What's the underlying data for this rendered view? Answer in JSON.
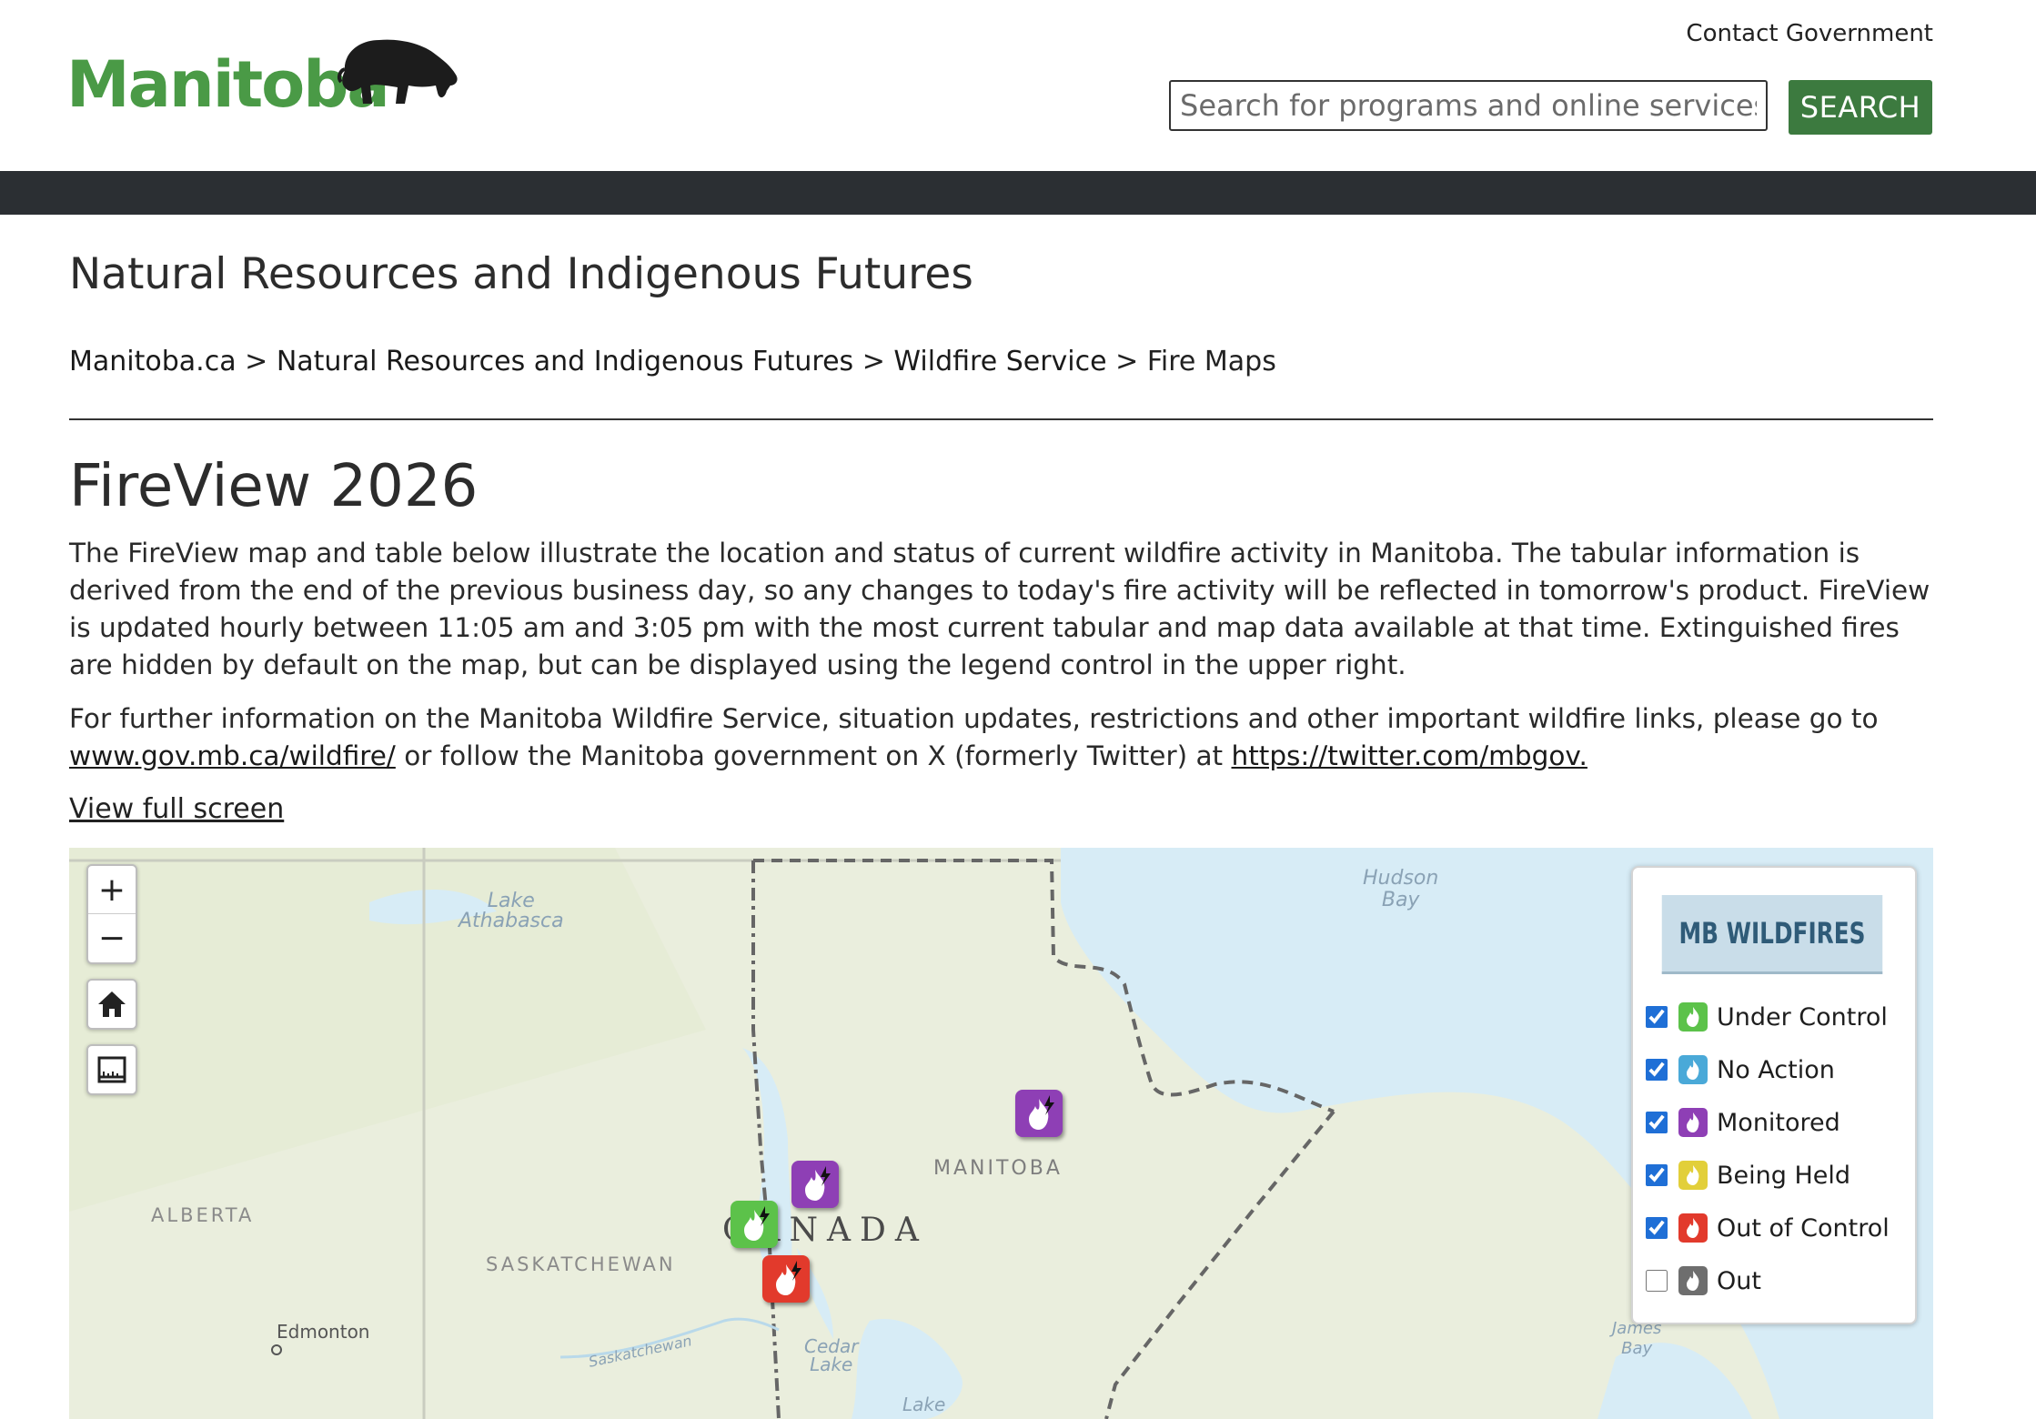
{
  "header": {
    "logo_text": "Manitoba",
    "contact_label": "Contact Government",
    "search_placeholder": "Search for programs and online services",
    "search_button": "SEARCH"
  },
  "department": "Natural Resources and Indigenous Futures",
  "breadcrumb": [
    "Manitoba.ca",
    ">",
    "Natural Resources and Indigenous Futures",
    ">",
    "Wildfire Service",
    ">",
    "Fire Maps"
  ],
  "page_title": "FireView 2026",
  "intro": "The FireView map and table below illustrate the location and status of current wildfire activity in Manitoba. The tabular information is derived from the end of the previous business day, so any changes to today's fire activity will be reflected in tomorrow's product. FireView is updated hourly between 11:05 am and 3:05 pm with the most current tabular and map data available at that time. Extinguished fires are hidden by default on the map, but can be displayed using the legend control in the upper right.",
  "info": {
    "text_before": "For further information on the Manitoba Wildfire Service, situation updates, restrictions and other important wildfire links, please go to",
    "link1": "www.gov.mb.ca/wildfire/",
    "text_middle": "or follow the Manitoba government on X (formerly Twitter) at",
    "link2": "https://twitter.com/mbgov."
  },
  "fullscreen_link": "View full screen",
  "map": {
    "controls": {
      "zoom_in": "+",
      "zoom_out": "−"
    },
    "labels": {
      "hudson_bay_1": "Hudson",
      "hudson_bay_2": "Bay",
      "lake_athabasca_1": "Lake",
      "lake_athabasca_2": "Athabasca",
      "manitoba": "MANITOBA",
      "canada": "CANADA",
      "alberta": "ALBERTA",
      "saskatchewan": "SASKATCHEWAN",
      "edmonton": "Edmonton",
      "saskatchewan_river": "Saskatchewan",
      "cedar_lake_1": "Cedar",
      "cedar_lake_2": "Lake",
      "lake": "Lake",
      "james_bay_1": "James",
      "james_bay_2": "Bay"
    },
    "legend": {
      "title": "MB WILDFIRES",
      "items": [
        {
          "label": "Under Control",
          "checked": true,
          "color": "#5cc24a"
        },
        {
          "label": "No Action",
          "checked": true,
          "color": "#4aa9d8"
        },
        {
          "label": "Monitored",
          "checked": true,
          "color": "#8e3fb5"
        },
        {
          "label": "Being Held",
          "checked": true,
          "color": "#e2cf3a"
        },
        {
          "label": "Out of Control",
          "checked": true,
          "color": "#e23a2c"
        },
        {
          "label": "Out",
          "checked": false,
          "color": "#6e6e6e"
        }
      ]
    }
  }
}
